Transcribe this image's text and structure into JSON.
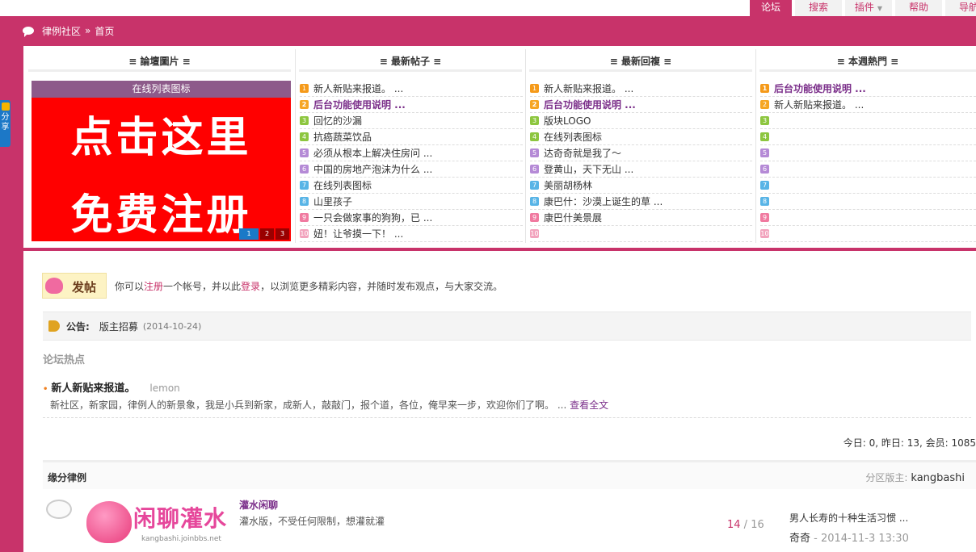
{
  "topnav": {
    "tabs": [
      {
        "label": "论坛",
        "active": true
      },
      {
        "label": "搜索",
        "active": false
      },
      {
        "label": "插件",
        "active": false
      },
      {
        "label": "帮助",
        "active": false
      },
      {
        "label": "导航",
        "active": false
      }
    ]
  },
  "breadcrumb": {
    "site": "律例社区",
    "sep": "»",
    "page": "首页"
  },
  "share": {
    "label": "分享"
  },
  "columns": {
    "images": "≡ 論壇圖片 ≡",
    "latest_posts": "≡ 最新帖子 ≡",
    "latest_replies": "≡ 最新回複 ≡",
    "weekly_hot": "≡ 本週熱門 ≡"
  },
  "slide": {
    "caption": "在线列表图标",
    "line1": "点击这里",
    "line2": "免费注册",
    "pages": [
      "1",
      "2",
      "3"
    ]
  },
  "latest_posts": [
    {
      "n": "1",
      "title": "新人新贴来报道。 ...",
      "strong": false
    },
    {
      "n": "2",
      "title": "后台功能使用说明 ...",
      "strong": true
    },
    {
      "n": "3",
      "title": "回忆的沙漏",
      "strong": false
    },
    {
      "n": "4",
      "title": "抗癌蔬菜饮品",
      "strong": false
    },
    {
      "n": "5",
      "title": "必须从根本上解决住房问 ...",
      "strong": false
    },
    {
      "n": "6",
      "title": "中国的房地产泡沫为什么 ...",
      "strong": false
    },
    {
      "n": "7",
      "title": "在线列表图标",
      "strong": false
    },
    {
      "n": "8",
      "title": "山里孩子",
      "strong": false
    },
    {
      "n": "9",
      "title": "一只会做家事的狗狗，已 ...",
      "strong": false
    },
    {
      "n": "10",
      "title": "妞！让爷摸一下！ ...",
      "strong": false
    }
  ],
  "latest_replies": [
    {
      "n": "1",
      "title": "新人新贴来报道。 ...",
      "strong": false
    },
    {
      "n": "2",
      "title": "后台功能使用说明 ...",
      "strong": true
    },
    {
      "n": "3",
      "title": "版块LOGO",
      "strong": false
    },
    {
      "n": "4",
      "title": "在线列表图标",
      "strong": false
    },
    {
      "n": "5",
      "title": "达奇奇就是我了～",
      "strong": false
    },
    {
      "n": "6",
      "title": "登黄山，天下无山 ...",
      "strong": false
    },
    {
      "n": "7",
      "title": "美丽胡杨林",
      "strong": false
    },
    {
      "n": "8",
      "title": "康巴什：沙漠上诞生的草 ...",
      "strong": false
    },
    {
      "n": "9",
      "title": "康巴什美景展",
      "strong": false
    },
    {
      "n": "10",
      "title": "",
      "strong": false
    }
  ],
  "weekly_hot": [
    {
      "n": "1",
      "title": "后台功能使用说明 ...",
      "strong": true
    },
    {
      "n": "2",
      "title": "新人新贴来报道。 ...",
      "strong": false
    },
    {
      "n": "3",
      "title": "",
      "strong": false
    },
    {
      "n": "4",
      "title": "",
      "strong": false
    },
    {
      "n": "5",
      "title": "",
      "strong": false
    },
    {
      "n": "6",
      "title": "",
      "strong": false
    },
    {
      "n": "7",
      "title": "",
      "strong": false
    },
    {
      "n": "8",
      "title": "",
      "strong": false
    },
    {
      "n": "9",
      "title": "",
      "strong": false
    },
    {
      "n": "10",
      "title": "",
      "strong": false
    }
  ],
  "post_area": {
    "icon_text": "发帖",
    "msg_pre": "你可以",
    "register": "注册",
    "msg_mid1": "一个帐号，并以此",
    "login": "登录",
    "msg_post": "，以浏览更多精彩内容，并随时发布观点，与大家交流。"
  },
  "notice": {
    "label": "公告:",
    "title": "版主招募",
    "date": "(2014-10-24)"
  },
  "hot_section": {
    "title": "论坛热点"
  },
  "hot_item": {
    "title": "新人新贴来报道。",
    "author": "lemon",
    "body": "新社区，新家园，律例人的新景象，我是小兵到新家，成新人，敲敲门，报个道，各位，俺早来一步，欢迎你们了啊。 ...",
    "more": "查看全文"
  },
  "stats": {
    "text": "今日: 0, 昨日: 13, 会员: 1085"
  },
  "category": {
    "name": "缘分律例",
    "mod_label": "分区版主:",
    "mod_name": "kangbashi"
  },
  "forum": {
    "logo_text": "闲聊灌水",
    "logo_url": "kangbashi.joinbbs.net",
    "name": "灌水闲聊",
    "desc": "灌水版，不受任何限制，想灌就灌",
    "threads": "14",
    "slash": " / ",
    "posts": "16",
    "last_title": "男人长寿的十种生活习惯 ...",
    "last_author": "奇奇",
    "last_time": " - 2014-11-3 13:30"
  }
}
